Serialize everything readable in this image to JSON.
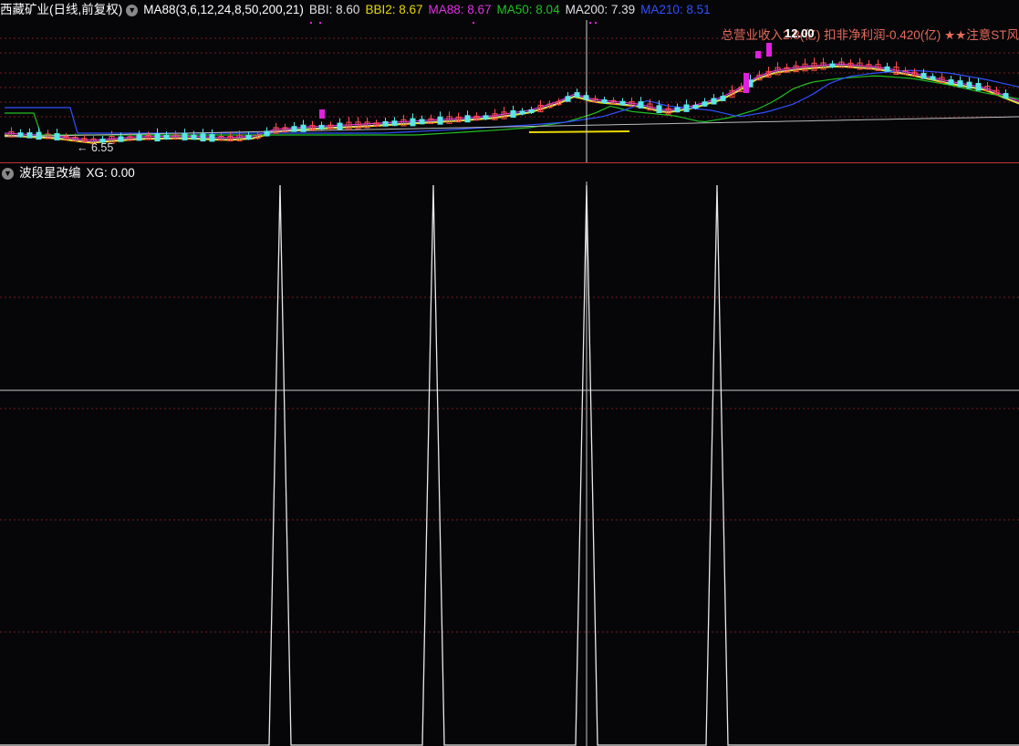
{
  "main": {
    "title": "西藏矿业(日线,前复权)",
    "indicator_title": "MA88(3,6,12,24,8,50,200,21)",
    "bbi": "BBI: 8.60",
    "bbi2": "BBI2: 8.67",
    "ma88": "MA88: 8.67",
    "ma50": "MA50: 8.04",
    "ma200": "MA200: 7.39",
    "ma210": "MA210: 8.51",
    "fin_info": "总营业收入2.8(亿) 扣非净利润-0.420(亿) ★★注意ST风",
    "price_label": "12.00",
    "low_label": "← 6.55",
    "colors": {
      "bbi": "#e0e0e0",
      "bbi2": "#e8e000",
      "ma88": "#e030e0",
      "ma50": "#20c020",
      "ma200": "#e0e0e0",
      "ma210": "#3050ff"
    }
  },
  "sub": {
    "title": "波段星改编",
    "xg": "XG: 0.00",
    "spike_count": 4
  },
  "crosshair": {
    "vertical": true,
    "horizontal": true
  }
}
